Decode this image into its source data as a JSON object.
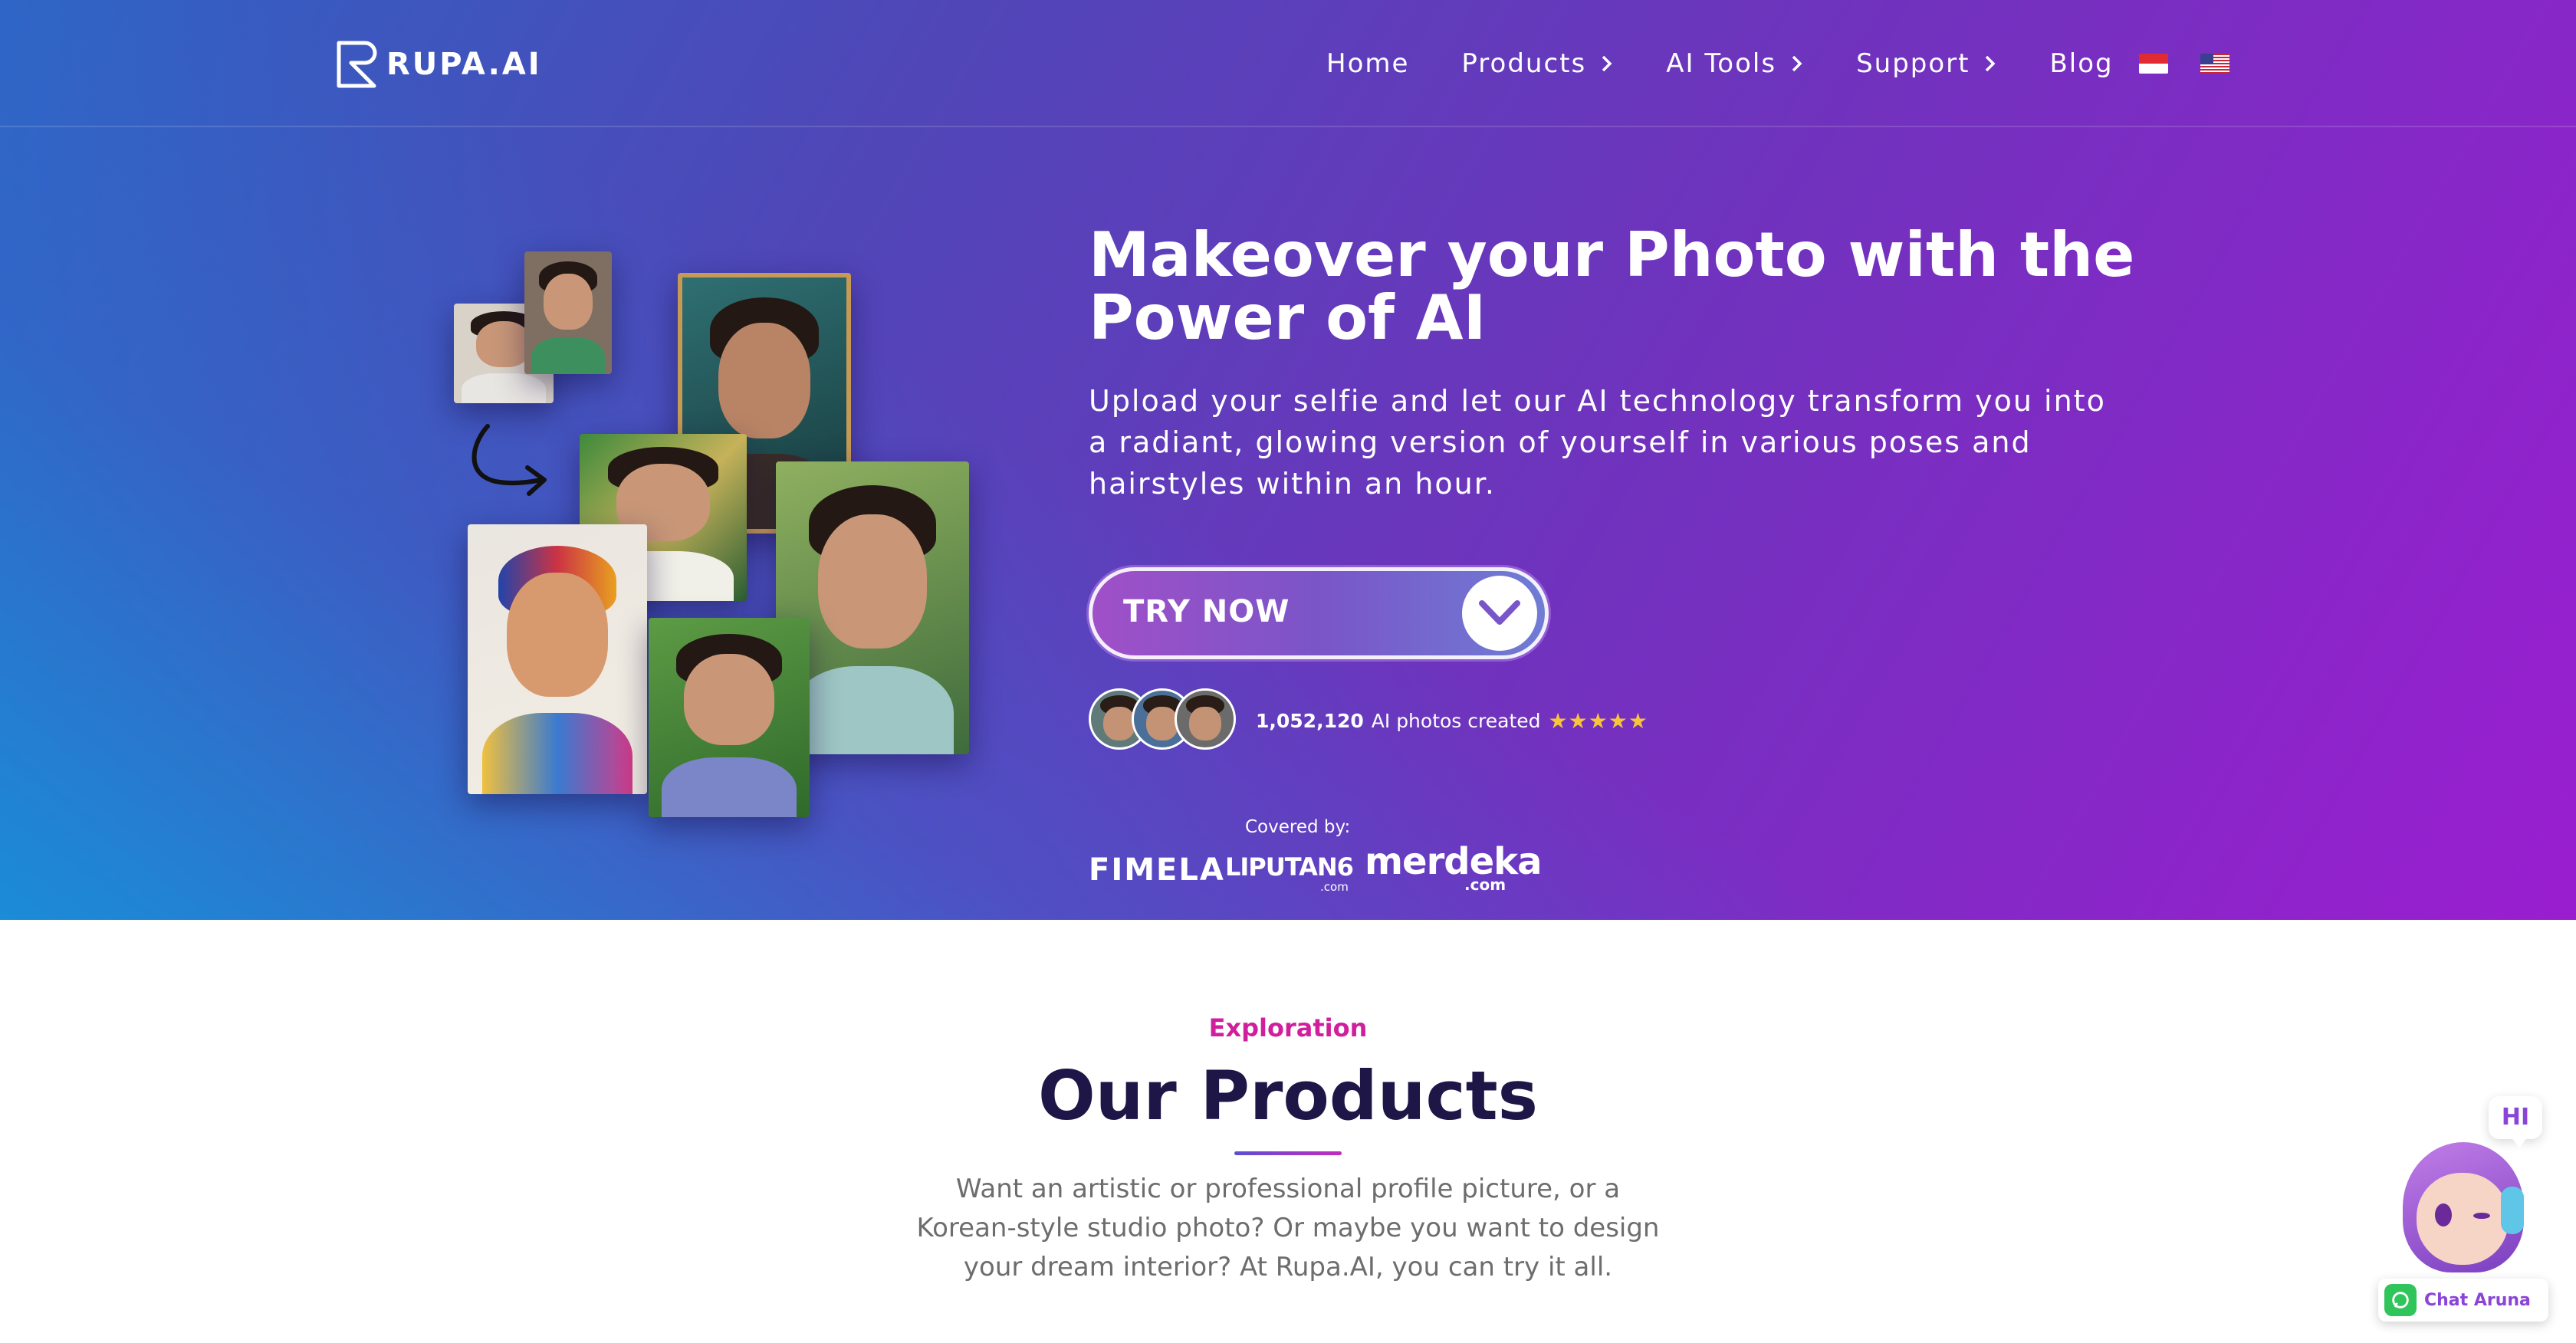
{
  "brand": {
    "logo_text": "RUPA.AI"
  },
  "nav": {
    "items": [
      {
        "label": "Home",
        "has_dropdown": false
      },
      {
        "label": "Products",
        "has_dropdown": true
      },
      {
        "label": "AI Tools",
        "has_dropdown": true
      },
      {
        "label": "Support",
        "has_dropdown": true
      },
      {
        "label": "Blog",
        "has_dropdown": false
      }
    ],
    "languages": [
      "flag-indonesia-icon",
      "flag-usa-icon"
    ]
  },
  "hero": {
    "title": "Makeover your Photo with the Power of AI",
    "subtitle": "Upload your selfie and let our AI technology transform you into a radiant, glowing version of yourself in various poses and hairstyles within an hour.",
    "cta_label": "TRY NOW",
    "stats_count": "1,052,120",
    "stats_text": "AI photos created",
    "stars": "★★★★★",
    "covered_by_label": "Covered by:",
    "media": {
      "fimela": "FIMELA",
      "liputan": "LIPUTAN6",
      "liputan_sub": ".com",
      "merdeka": "merdeka",
      "merdeka_sub": ".com"
    }
  },
  "products_section": {
    "tag": "Exploration",
    "title": "Our Products",
    "description": "Want an artistic or professional profile picture, or a Korean-style studio photo? Or maybe you want to design your dream interior? At Rupa.AI, you can try it all."
  },
  "chat_widget": {
    "bubble_text": "HI",
    "label": "Chat Aruna"
  },
  "colors": {
    "hero_gradient_start": "#2f63c4",
    "hero_gradient_end": "#9a1ed0",
    "accent_pink": "#d01f9c",
    "heading_dark": "#1d1646",
    "body_gray": "#6d6d6d",
    "star_gold": "#f7c43a",
    "whatsapp_green": "#2fc55a"
  }
}
